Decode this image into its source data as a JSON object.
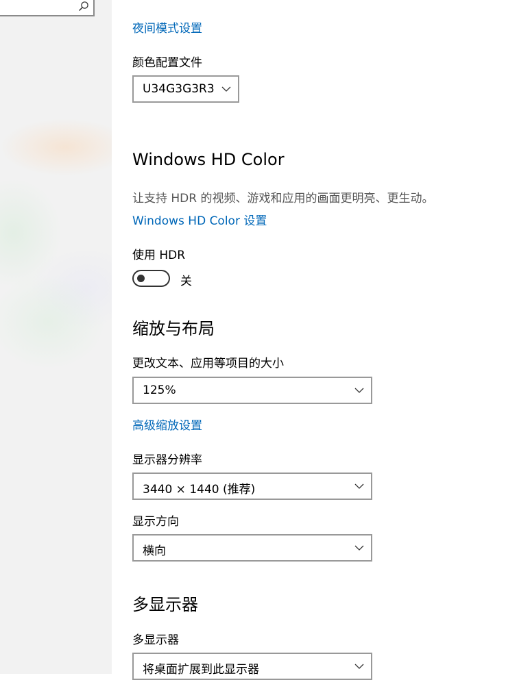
{
  "sidebar": {
    "search_icon": "search-icon"
  },
  "night_light_link": "夜间模式设置",
  "color_profile": {
    "label": "颜色配置文件",
    "selected": "U34G3G3R3"
  },
  "hd_color": {
    "heading": "Windows HD Color",
    "description": "让支持 HDR 的视频、游戏和应用的画面更明亮、更生动。",
    "settings_link": "Windows HD Color 设置",
    "hdr_label": "使用 HDR",
    "hdr_state": "关"
  },
  "scale_layout": {
    "heading": "缩放与布局",
    "scale_label": "更改文本、应用等项目的大小",
    "scale_value": "125%",
    "advanced_link": "高级缩放设置",
    "resolution_label": "显示器分辨率",
    "resolution_value": "3440 × 1440 (推荐)",
    "orientation_label": "显示方向",
    "orientation_value": "横向"
  },
  "multiple_displays": {
    "heading": "多显示器",
    "label": "多显示器",
    "value": "将桌面扩展到此显示器"
  },
  "colors": {
    "link": "#0067b8",
    "text": "#000000",
    "description": "#555555",
    "sidebar_bg": "#f2f2f2"
  }
}
